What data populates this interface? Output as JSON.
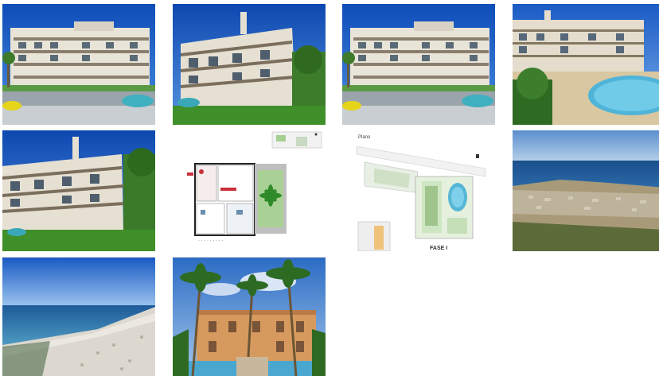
{
  "gallery": {
    "thumbnails": [
      {
        "name": "thumb-building-street-1",
        "subject": "apartment building with street and cars"
      },
      {
        "name": "thumb-building-angle",
        "subject": "apartment building angled view"
      },
      {
        "name": "thumb-building-street-2",
        "subject": "apartment building with street and cars"
      },
      {
        "name": "thumb-building-pool",
        "subject": "apartment building with pool"
      },
      {
        "name": "thumb-building-garden",
        "subject": "apartment building with garden"
      },
      {
        "name": "thumb-floor-plan",
        "subject": "apartment floor plan"
      },
      {
        "name": "thumb-site-plan",
        "subject": "site plan",
        "label": "FASE I",
        "corner_label": "Plano"
      },
      {
        "name": "thumb-aerial-coast",
        "subject": "aerial view of coastal town"
      },
      {
        "name": "thumb-beach",
        "subject": "pebble beach and sea"
      },
      {
        "name": "thumb-palm-building",
        "subject": "palm trees and building"
      }
    ]
  },
  "colors": {
    "sky": "#1e63c9",
    "building": "#e8e2d6",
    "grass": "#3f8f2a",
    "sea": "#1d5a9a"
  }
}
